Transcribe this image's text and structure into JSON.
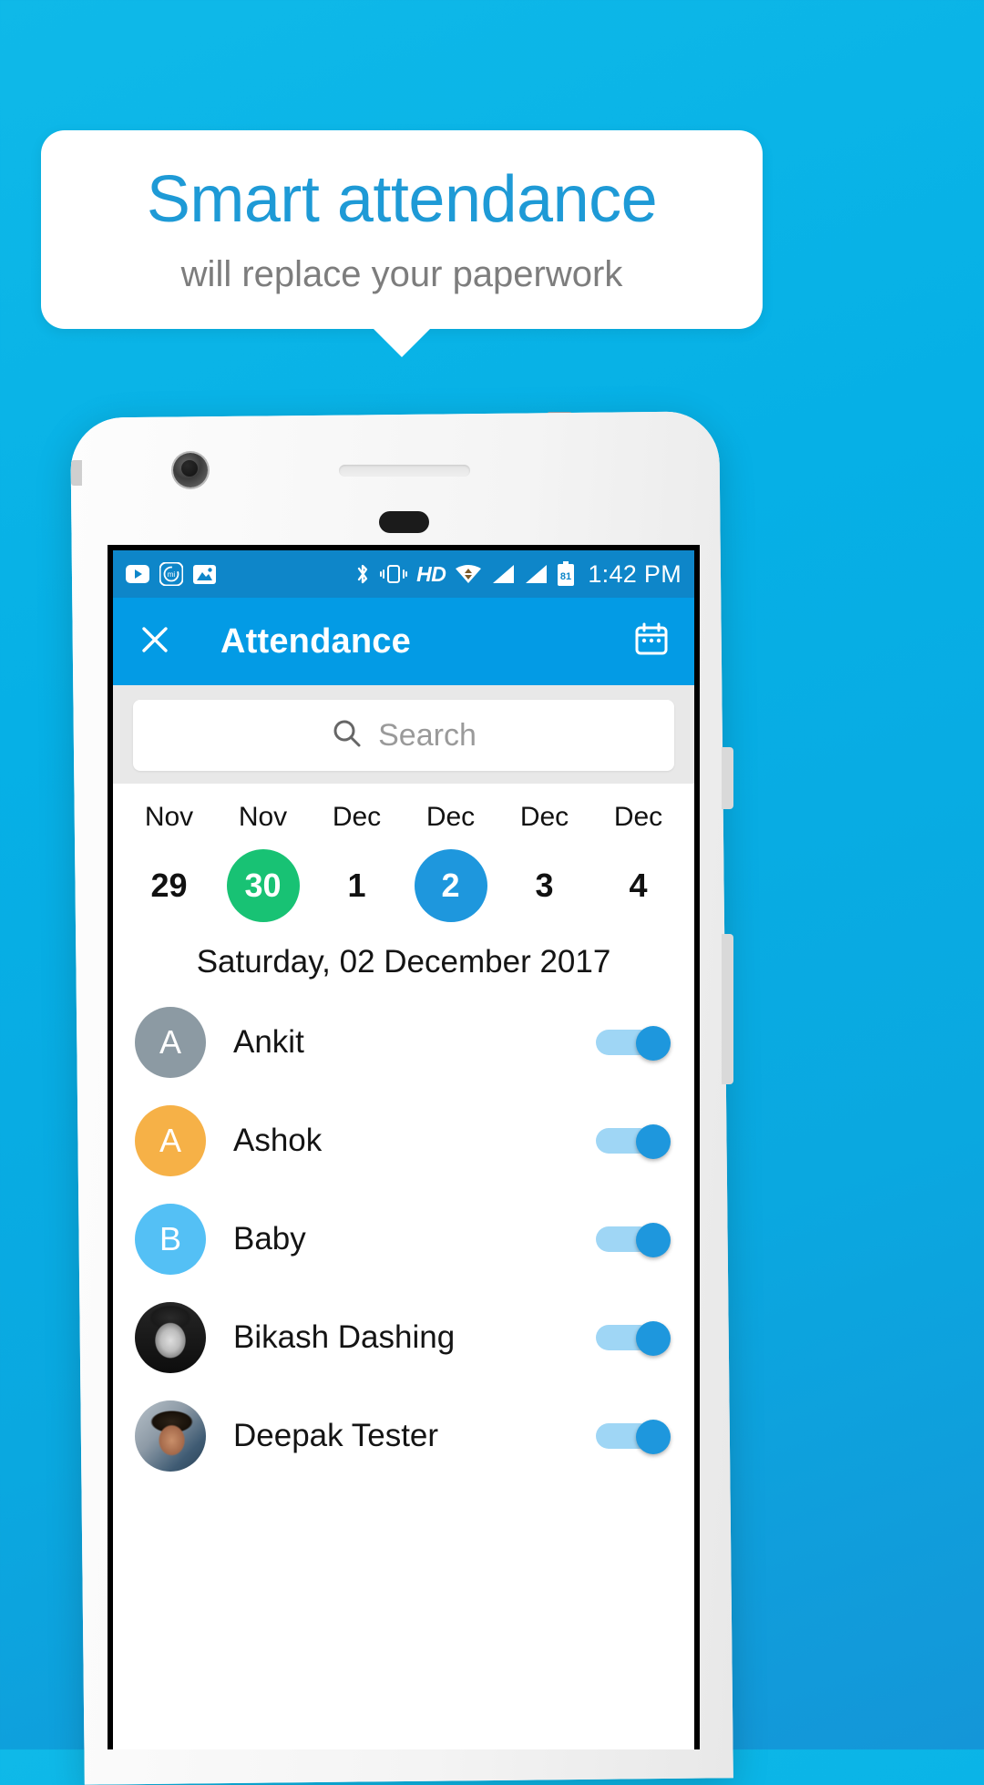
{
  "promo": {
    "title": "Smart attendance",
    "subtitle": "will replace your paperwork",
    "title_color": "#1e9ad6",
    "subtitle_color": "#7d7d7d",
    "background_color": "#06b0e6"
  },
  "statusbar": {
    "left_icons": [
      "youtube-icon",
      "mi-cleaner-icon",
      "gallery-icon"
    ],
    "right_icons": [
      "bluetooth-icon",
      "vibrate-icon",
      "hd-icon",
      "wifi-icon",
      "signal-icon-1",
      "signal-icon-2",
      "battery-icon"
    ],
    "hd_label": "HD",
    "battery_level": "81",
    "time": "1:42 PM"
  },
  "appbar": {
    "close_icon": "close-icon",
    "title": "Attendance",
    "calendar_icon": "calendar-icon",
    "background_color": "#039be5"
  },
  "search": {
    "icon": "search-icon",
    "placeholder": "Search"
  },
  "datestrip": {
    "days": [
      {
        "month": "Nov",
        "day": "29",
        "state": "normal"
      },
      {
        "month": "Nov",
        "day": "30",
        "state": "today"
      },
      {
        "month": "Dec",
        "day": "1",
        "state": "normal"
      },
      {
        "month": "Dec",
        "day": "2",
        "state": "selected"
      },
      {
        "month": "Dec",
        "day": "3",
        "state": "normal"
      },
      {
        "month": "Dec",
        "day": "4",
        "state": "normal"
      }
    ],
    "today_color": "#18c274",
    "selected_color": "#1e97dd"
  },
  "selected_date_label": "Saturday, 02 December 2017",
  "attendance_list": [
    {
      "name": "Ankit",
      "avatar_type": "letter",
      "initial": "A",
      "avatar_color": "#8c9aa3",
      "present": true
    },
    {
      "name": "Ashok",
      "avatar_type": "letter",
      "initial": "A",
      "avatar_color": "#f6b147",
      "present": true
    },
    {
      "name": "Baby",
      "avatar_type": "letter",
      "initial": "B",
      "avatar_color": "#54c0f5",
      "present": true
    },
    {
      "name": "Bikash Dashing",
      "avatar_type": "photo-dark",
      "initial": "",
      "avatar_color": "#1a1a1a",
      "present": true
    },
    {
      "name": "Deepak Tester",
      "avatar_type": "photo-color",
      "initial": "",
      "avatar_color": "#3f5b73",
      "present": true
    }
  ]
}
